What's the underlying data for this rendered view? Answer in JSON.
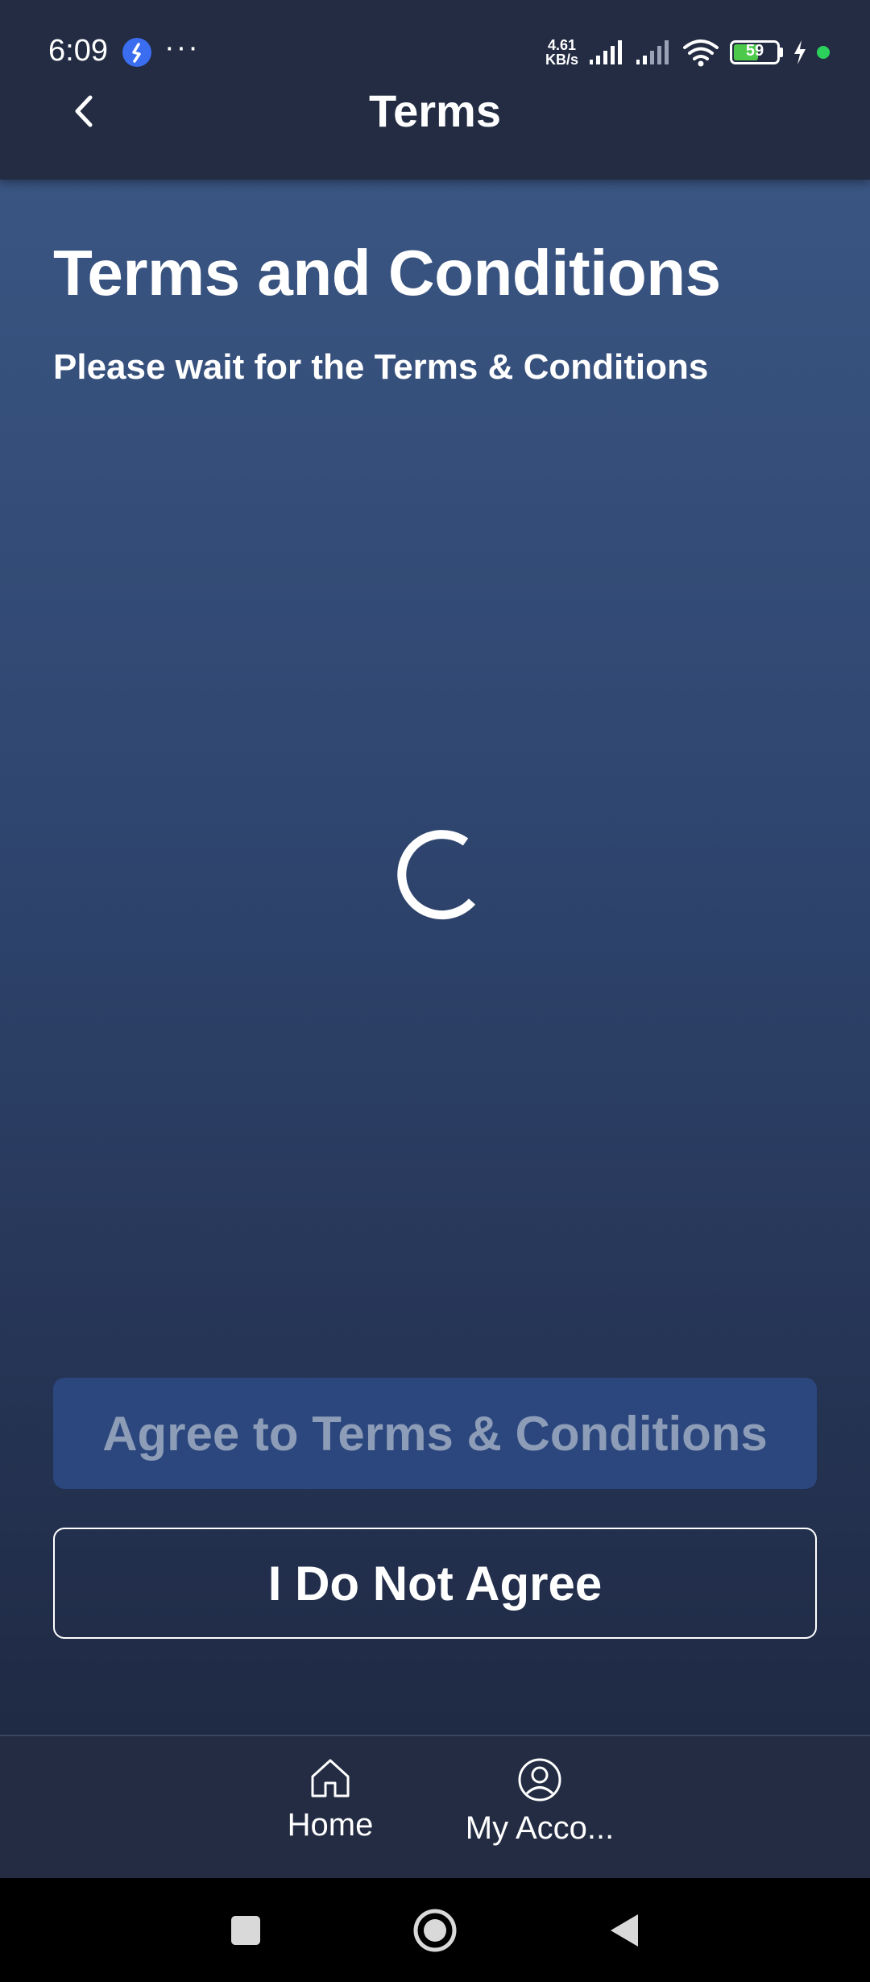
{
  "status_bar": {
    "time": "6:09",
    "more_indicator": "···",
    "net_speed_value": "4.61",
    "net_speed_unit": "KB/s",
    "battery_level": "59",
    "battery_percent": 59,
    "icons": [
      "app-notification-icon",
      "signal-icon",
      "signal-icon",
      "wifi-icon",
      "battery-icon",
      "charging-icon",
      "privacy-dot-icon"
    ]
  },
  "header": {
    "title": "Terms",
    "back_icon": "chevron-left-icon"
  },
  "main": {
    "heading": "Terms and Conditions",
    "subtitle": "Please wait for the Terms & Conditions",
    "loading_icon": "spinner-icon"
  },
  "actions": {
    "agree_label": "Agree to Terms & Conditions",
    "disagree_label": "I Do Not Agree"
  },
  "tabbar": {
    "tabs": [
      {
        "label": "Home",
        "icon": "home-icon"
      },
      {
        "label": "My Acco...",
        "icon": "user-circle-icon"
      }
    ]
  },
  "colors": {
    "header_bg": "#232c43",
    "content_gradient_top": "#3a5582",
    "content_gradient_bottom": "#1f2a44",
    "agree_bg": "#2b477e",
    "agree_text": "#8e9db7",
    "battery_green": "#4cc94a"
  }
}
